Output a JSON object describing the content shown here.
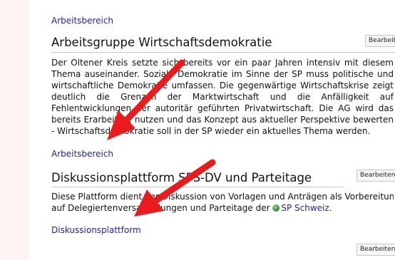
{
  "top_link": "Arbeitsbereich",
  "sections": [
    {
      "heading": "Arbeitsgruppe Wirtschaftsdemokratie",
      "edit_label": "Bearbeiten",
      "lines": [
        "Der Oltener Kreis setzte sich bereits vor ein paar Jahren intensiv mit diesem",
        "Thema auseinander. Soziale Demokratie im Sinne der SP muss politische und",
        "wirtschaftliche Demokratie umfassen. Die gegenwärtige Wirtschaftskrise zeigt",
        "deutlich die Grenzen der Marktwirtschaft und die Anfälligkeit auf",
        "Fehlentwicklungen der autoritär geführten Privatwirtschaft. Die AG wird das",
        "bereits Erarbeitete nutzen und das Konzept aus aktueller Perspektive bewerten",
        "- Wirtschaftsdemokratie soll in der SP wieder ein aktuelles Thema werden."
      ],
      "link": "Arbeitsbereich"
    },
    {
      "heading": "Diskussionsplattform SPS-DV und Parteitage",
      "edit_label": "Bearbeiten",
      "lines": [
        "Diese Plattform dient der Diskussion von Vorlagen und Anträgen als Vorbereitung",
        "auf Delegiertenversammlungen und Parteitage der"
      ],
      "inline_link": "SP Schweiz",
      "after_link": ".",
      "link": "Diskussionsplattform"
    }
  ],
  "bottom_edit_label": "Bearbeiten",
  "colors": {
    "link": "#1f1fb0",
    "arrow": "#e81c1c",
    "left_strip": "#fdf3f3"
  }
}
